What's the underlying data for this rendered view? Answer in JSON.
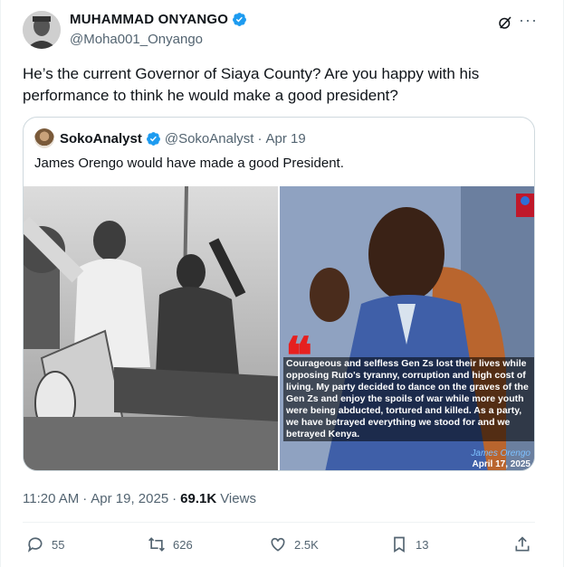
{
  "author": {
    "name": "MUHAMMAD ONYANGO",
    "handle": "@Moha001_Onyango"
  },
  "tweet": {
    "text": "He’s the current Governor of Siaya County? Are you happy with his performance to think he would make a good president?"
  },
  "quote": {
    "name": "SokoAnalyst",
    "handle": "@SokoAnalyst",
    "separator": "·",
    "date": "Apr 19",
    "text": "James Orengo would have made a good President.",
    "overlay": {
      "quote_text": "Courageous and selfless Gen Zs lost their lives while opposing Ruto's tyranny, corruption and high cost of living. My party decided to dance on the graves of the Gen Zs and enjoy the spoils of war while more youth were being abducted, tortured and killed. As a party, we have betrayed everything we stood for and we betrayed Kenya.",
      "attribution_name": "James Orengo",
      "attribution_date": "April 17, 2025",
      "quote_mark": "❝"
    }
  },
  "meta": {
    "time": "11:20 AM",
    "sep": "·",
    "date": "Apr 19, 2025",
    "sep2": "·",
    "views_count": "69.1K",
    "views_label": "Views"
  },
  "actions": {
    "replies": "55",
    "reposts": "626",
    "likes": "2.5K",
    "bookmarks": "13"
  },
  "colors": {
    "verified": "#1d9bf0",
    "text_secondary": "#536471",
    "border": "#cfd9de"
  },
  "icons": [
    "verified-badge-icon",
    "grok-icon",
    "more-icon",
    "reply-icon",
    "repost-icon",
    "like-icon",
    "bookmark-icon",
    "share-icon"
  ]
}
